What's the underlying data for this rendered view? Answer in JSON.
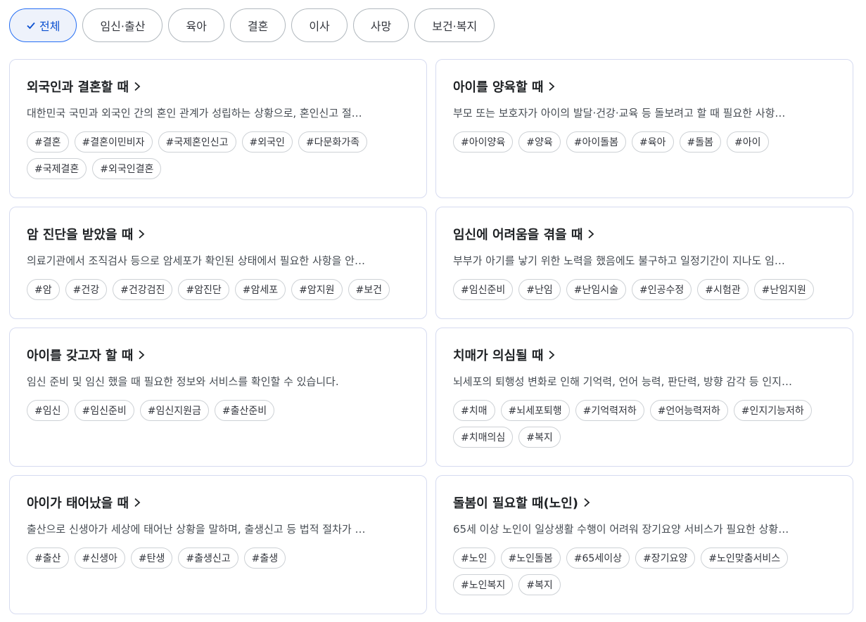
{
  "filters": [
    {
      "label": "전체",
      "active": true
    },
    {
      "label": "임신·출산",
      "active": false
    },
    {
      "label": "육아",
      "active": false
    },
    {
      "label": "결혼",
      "active": false
    },
    {
      "label": "이사",
      "active": false
    },
    {
      "label": "사망",
      "active": false
    },
    {
      "label": "보건·복지",
      "active": false
    }
  ],
  "cards": [
    {
      "title": "외국인과 결혼할 때",
      "desc": "대한민국 국민과 외국인 간의 혼인 관계가 성립하는 상황으로, 혼인신고 절…",
      "tags": [
        "#결혼",
        "#결혼이민비자",
        "#국제혼인신고",
        "#외국인",
        "#다문화가족",
        "#국제결혼",
        "#외국인결혼"
      ]
    },
    {
      "title": "아이를 양육할 때",
      "desc": "부모 또는 보호자가 아이의 발달·건강·교육 등 돌보려고 할 때 필요한 사항…",
      "tags": [
        "#아이양육",
        "#양육",
        "#아이돌봄",
        "#육아",
        "#돌봄",
        "#아이"
      ]
    },
    {
      "title": "암 진단을 받았을 때",
      "desc": "의료기관에서 조직검사 등으로 암세포가 확인된 상태에서 필요한 사항을 안…",
      "tags": [
        "#암",
        "#건강",
        "#건강검진",
        "#암진단",
        "#암세포",
        "#암지원",
        "#보건"
      ]
    },
    {
      "title": "임신에 어려움을 겪을 때",
      "desc": "부부가 아기를 낳기 위한 노력을 했음에도 불구하고 일정기간이 지나도 임…",
      "tags": [
        "#임신준비",
        "#난임",
        "#난임시술",
        "#인공수정",
        "#시험관",
        "#난임지원"
      ]
    },
    {
      "title": "아이를 갖고자 할 때",
      "desc": "임신 준비 및 임신 했을 때 필요한 정보와 서비스를 확인할 수 있습니다.",
      "tags": [
        "#임신",
        "#임신준비",
        "#임신지원금",
        "#출산준비"
      ]
    },
    {
      "title": "치매가 의심될 때",
      "desc": "뇌세포의 퇴행성 변화로 인해 기억력, 언어 능력, 판단력, 방향 감각 등 인지…",
      "tags": [
        "#치매",
        "#뇌세포퇴행",
        "#기억력저하",
        "#언어능력저하",
        "#인지기능저하",
        "#치매의심",
        "#복지"
      ]
    },
    {
      "title": "아이가 태어났을 때",
      "desc": "출산으로 신생아가 세상에 태어난 상황을 말하며, 출생신고 등 법적 절차가 …",
      "tags": [
        "#출산",
        "#신생아",
        "#탄생",
        "#출생신고",
        "#출생"
      ]
    },
    {
      "title": "돌봄이 필요할 때(노인)",
      "desc": "65세 이상 노인이 일상생활 수행이 어려워 장기요양 서비스가 필요한 상황…",
      "tags": [
        "#노인",
        "#노인돌봄",
        "#65세이상",
        "#장기요양",
        "#노인맞춤서비스",
        "#노인복지",
        "#복지"
      ]
    }
  ],
  "colors": {
    "accent": "#256ef4",
    "active_bg": "#eef2fb",
    "border": "#cdd1d5"
  }
}
